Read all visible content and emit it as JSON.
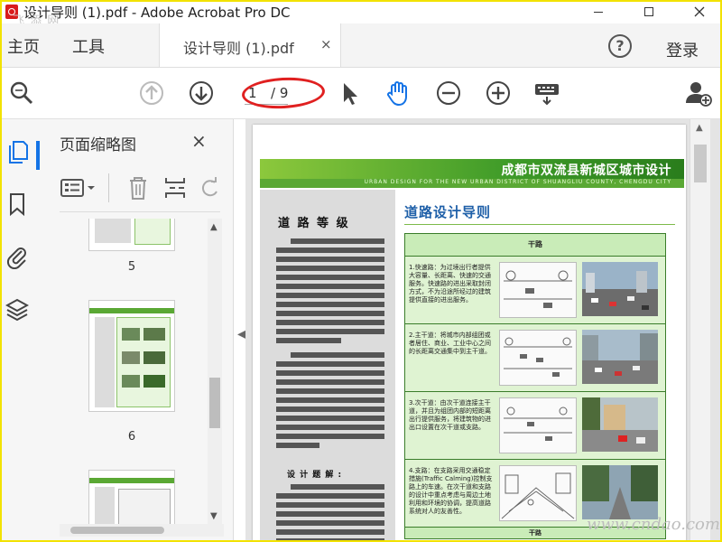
{
  "window": {
    "title": "设计导则 (1).pdf - Adobe Acrobat Pro DC",
    "watermark_top": "飞 添 网",
    "watermark_bottom": "www.cndao.com"
  },
  "menubar": {
    "home": "主页",
    "tools": "工具",
    "doc_tab": "设计导则 (1).pdf",
    "close_tab": "×",
    "help": "?",
    "login": "登录"
  },
  "toolbar": {
    "current_page": "1",
    "total_pages": "/ 9",
    "icons": [
      "search-zoom-icon",
      "page-up-icon",
      "page-down-icon",
      "select-arrow-icon",
      "hand-tool-icon",
      "zoom-out-icon",
      "zoom-in-icon",
      "keyboard-fit-icon",
      "add-user-icon"
    ]
  },
  "sidebar": {
    "panel_title": "页面缩略图",
    "close": "×",
    "thumbnails": [
      {
        "label": "5"
      },
      {
        "label": "6"
      },
      {
        "label": ""
      }
    ]
  },
  "page": {
    "banner_title": "成都市双流县新城区城市设计",
    "banner_subtitle": "URBAN DESIGN FOR THE NEW URBAN DISTRICT OF SHUANGLIU COUNTY, CHENGDU CITY",
    "section_title": "道 路 等 级",
    "sub_title": "设 计 题 解 :",
    "guide_title": "道路设计导则",
    "table_header": "干路",
    "rows": [
      {
        "text": "1.快速路：为过境出行者提供大容量、长距离、快速的交通服务。快速路的进出采取封闭方式，不为沿途所经过的建筑提供直接的进出服务。"
      },
      {
        "text": "2.主干道：将城市内部组团或者居住、商业、工业中心之间的长距离交通集中到主干道。"
      },
      {
        "text": "3.次干道：由次干道连接主干道，并且为组团内部的短距离出行提供服务，将建筑物的进出口设置在次干道或支路。"
      },
      {
        "text": "4.支路：在支路采用交通稳定措施(Traffic Calming)控制支路上的车速。在次干道和支路的设计中重点考虑与周边土地利用和环境的协调，提高道路系统对人的友善性。"
      }
    ],
    "table_footer": "干路"
  },
  "colors": {
    "accent": "#1473e6",
    "banner_green": "#3d9a28",
    "annotation_red": "#e02020"
  }
}
